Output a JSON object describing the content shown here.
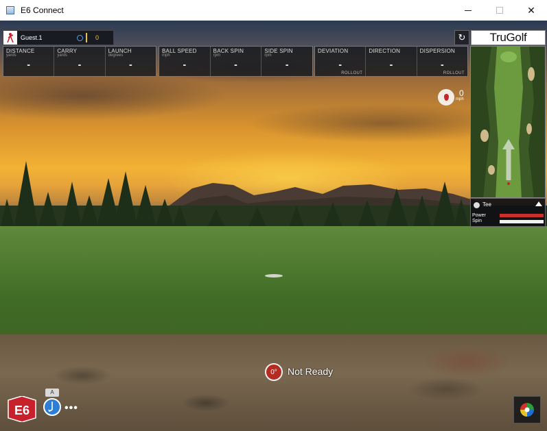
{
  "window": {
    "title": "E6 Connect",
    "minimize": "–",
    "close": "✕"
  },
  "player": {
    "name": "Guest.1",
    "score": "0"
  },
  "stats": {
    "panel1": [
      {
        "label": "DISTANCE",
        "unit": "yards",
        "value": "-"
      },
      {
        "label": "CARRY",
        "unit": "yards",
        "value": "-"
      },
      {
        "label": "LAUNCH",
        "unit": "degrees",
        "value": "-"
      }
    ],
    "panel2": [
      {
        "label": "BALL SPEED",
        "unit": "mph",
        "value": "-"
      },
      {
        "label": "BACK SPIN",
        "unit": "rpm",
        "value": "-"
      },
      {
        "label": "SIDE SPIN",
        "unit": "rpm",
        "value": "-"
      }
    ],
    "panel3": [
      {
        "label": "DEVIATION",
        "unit": "",
        "value": "-",
        "sub": "ROLLOUT"
      },
      {
        "label": "DIRECTION",
        "unit": "",
        "value": "-",
        "sub": ""
      },
      {
        "label": "DISPERSION",
        "unit": "",
        "value": "-",
        "sub": "ROLLOUT"
      }
    ]
  },
  "brand": "TruGolf",
  "wind": {
    "speed": "0",
    "unit": "mph"
  },
  "minimap": {
    "lie": "Tee",
    "power_label": "Power",
    "spin_label": "Spin"
  },
  "status": {
    "aim": "0°",
    "text": "Not Ready"
  },
  "club": {
    "letter": "A"
  },
  "more": "•••",
  "colors": {
    "accent_yellow": "#e7c33a",
    "power_red": "#c9302c",
    "club_blue": "#2c7ed6",
    "status_red": "#b52a22"
  }
}
